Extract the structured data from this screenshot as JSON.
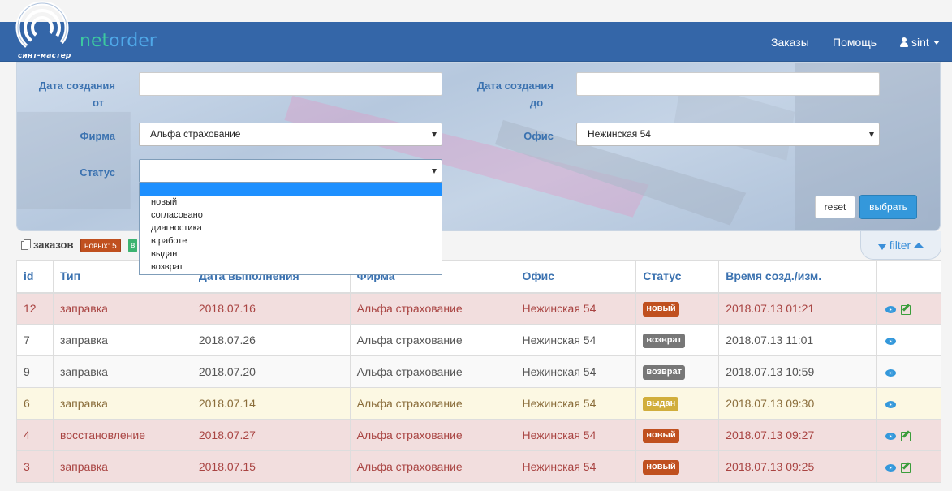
{
  "header": {
    "logo_subtitle": "синт-мастер",
    "brand_net": "net",
    "brand_order": "order",
    "nav": {
      "orders": "Заказы",
      "help": "Помощь",
      "user": "sint"
    }
  },
  "filters": {
    "date_from_label_line1": "Дата создания",
    "date_from_label_line2": "от",
    "date_to_label_line1": "Дата создания",
    "date_to_label_line2": "до",
    "date_from_value": "",
    "date_to_value": "",
    "firm_label": "Фирма",
    "firm_value": "Альфа страхование",
    "office_label": "Офис",
    "office_value": "Нежинская 54",
    "status_label": "Статус",
    "status_value": "",
    "status_options": [
      "",
      "новый",
      "согласовано",
      "диагностика",
      "в работе",
      "выдан",
      "возврат"
    ],
    "reset_label": "reset",
    "submit_label": "выбрать",
    "toggle_label": "filter"
  },
  "summary": {
    "label": "заказов",
    "new_badge": "новых: 5",
    "second_badge": "в"
  },
  "colors": {
    "navbar": "#3466a8",
    "accent": "#3498db",
    "status_new": "#c0501f",
    "status_return": "#777777",
    "status_issued": "#d1ae3c"
  },
  "table": {
    "headers": [
      "id",
      "Тип",
      "Дата выполнения",
      "Фирма",
      "Офис",
      "Статус",
      "Время созд./изм.",
      ""
    ],
    "rows": [
      {
        "id": "12",
        "type": "заправка",
        "due": "2018.07.16",
        "firm": "Альфа страхование",
        "office": "Нежинская 54",
        "status": "новый",
        "time": "2018.07.13 01:21",
        "editable": true
      },
      {
        "id": "7",
        "type": "заправка",
        "due": "2018.07.26",
        "firm": "Альфа страхование",
        "office": "Нежинская 54",
        "status": "возврат",
        "time": "2018.07.13 11:01",
        "editable": false
      },
      {
        "id": "9",
        "type": "заправка",
        "due": "2018.07.20",
        "firm": "Альфа страхование",
        "office": "Нежинская 54",
        "status": "возврат",
        "time": "2018.07.13 10:59",
        "editable": false
      },
      {
        "id": "6",
        "type": "заправка",
        "due": "2018.07.14",
        "firm": "Альфа страхование",
        "office": "Нежинская 54",
        "status": "выдан",
        "time": "2018.07.13 09:30",
        "editable": false
      },
      {
        "id": "4",
        "type": "восстановление",
        "due": "2018.07.27",
        "firm": "Альфа страхование",
        "office": "Нежинская 54",
        "status": "новый",
        "time": "2018.07.13 09:27",
        "editable": true
      },
      {
        "id": "3",
        "type": "заправка",
        "due": "2018.07.15",
        "firm": "Альфа страхование",
        "office": "Нежинская 54",
        "status": "новый",
        "time": "2018.07.13 09:25",
        "editable": true
      }
    ]
  }
}
